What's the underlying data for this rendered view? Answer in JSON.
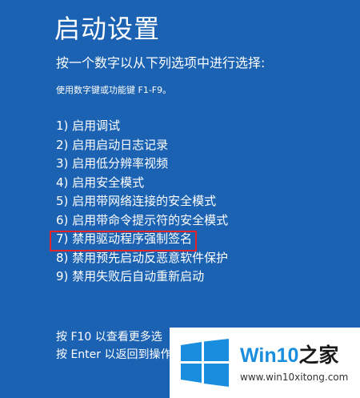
{
  "page": {
    "title": "启动设置",
    "prompt": "按一个数字以从下列选项中进行选择:",
    "hint": "使用数字键或功能键 F1-F9。"
  },
  "options": [
    "1) 启用调试",
    "2) 启用启动日志记录",
    "3) 启用低分辨率视频",
    "4) 启用安全模式",
    "5) 启用带网络连接的安全模式",
    "6) 启用带命令提示符的安全模式",
    "7) 禁用驱动程序强制签名",
    "8) 禁用预先启动反恶意软件保护",
    "9) 禁用失败后自动重新启动"
  ],
  "highlighted_option_index": 6,
  "footer": {
    "line1": "按 F10 以查看更多选",
    "line2": "按 Enter 以返回到操作"
  },
  "watermark": {
    "brand_prefix": "Win10",
    "brand_suffix": "之家",
    "site": "www.win10xitong.com",
    "logo_icon": "windows-logo-icon"
  },
  "colors": {
    "background": "#1b62b3",
    "text": "#ffffff",
    "highlight_border": "#e2242b",
    "brand_blue": "#1a8ede"
  }
}
